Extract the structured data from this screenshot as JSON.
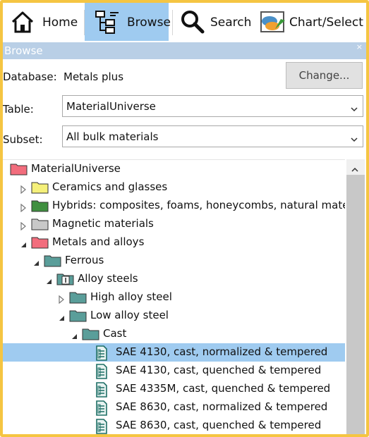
{
  "toolbar": {
    "home_label": "Home",
    "browse_label": "Browse",
    "search_label": "Search",
    "chart_label": "Chart/Select",
    "active_tab": "Browse"
  },
  "panel": {
    "title": "Browse",
    "close_glyph": "×"
  },
  "database": {
    "label": "Database:",
    "value": "Metals plus",
    "change_button": "Change..."
  },
  "table": {
    "label": "Table:",
    "value": "MaterialUniverse"
  },
  "subset": {
    "label": "Subset:",
    "value": "All bulk materials"
  },
  "tree": {
    "rows": [
      {
        "label": "MaterialUniverse",
        "icon": "folder-red-icon",
        "expander": "none",
        "folder_color": "#f26d7d"
      },
      {
        "label": "Ceramics and glasses",
        "icon": "folder-yellow-icon",
        "expander": "collapsed",
        "folder_color": "#f5f07a"
      },
      {
        "label": "Hybrids: composites, foams, honeycombs, natural materi",
        "icon": "folder-green-icon",
        "expander": "collapsed",
        "folder_color": "#3f8f3f"
      },
      {
        "label": "Magnetic materials",
        "icon": "folder-gray-icon",
        "expander": "collapsed",
        "folder_color": "#c8c8c8"
      },
      {
        "label": "Metals and alloys",
        "icon": "folder-red-icon",
        "expander": "expanded",
        "folder_color": "#f26d7d"
      },
      {
        "label": "Ferrous",
        "icon": "folder-teal-icon",
        "expander": "expanded",
        "folder_color": "#5a9e9a"
      },
      {
        "label": "Alloy steels",
        "icon": "folder-info-icon",
        "expander": "expanded",
        "folder_color": "#5a9e9a"
      },
      {
        "label": "High alloy steel",
        "icon": "folder-teal-icon",
        "expander": "collapsed",
        "folder_color": "#5a9e9a"
      },
      {
        "label": "Low alloy steel",
        "icon": "folder-teal-icon",
        "expander": "expanded",
        "folder_color": "#5a9e9a"
      },
      {
        "label": "Cast",
        "icon": "folder-teal-icon",
        "expander": "expanded",
        "folder_color": "#5a9e9a"
      },
      {
        "label": "SAE 4130, cast, normalized & tempered",
        "icon": "datasheet-icon",
        "expander": "none",
        "selected": true
      },
      {
        "label": "SAE 4130, cast, quenched & tempered",
        "icon": "datasheet-icon",
        "expander": "none"
      },
      {
        "label": "SAE 4335M, cast, quenched & tempered",
        "icon": "datasheet-icon",
        "expander": "none"
      },
      {
        "label": "SAE 8630, cast, normalized & tempered",
        "icon": "datasheet-icon",
        "expander": "none"
      },
      {
        "label": "SAE 8630, cast, quenched & tempered",
        "icon": "datasheet-icon",
        "expander": "none"
      }
    ]
  },
  "colors": {
    "accent_selected": "#9fcbf0",
    "panel_header": "#b9cfe6",
    "frame_border": "#f5c542",
    "teal_folder": "#5a9e9a"
  }
}
